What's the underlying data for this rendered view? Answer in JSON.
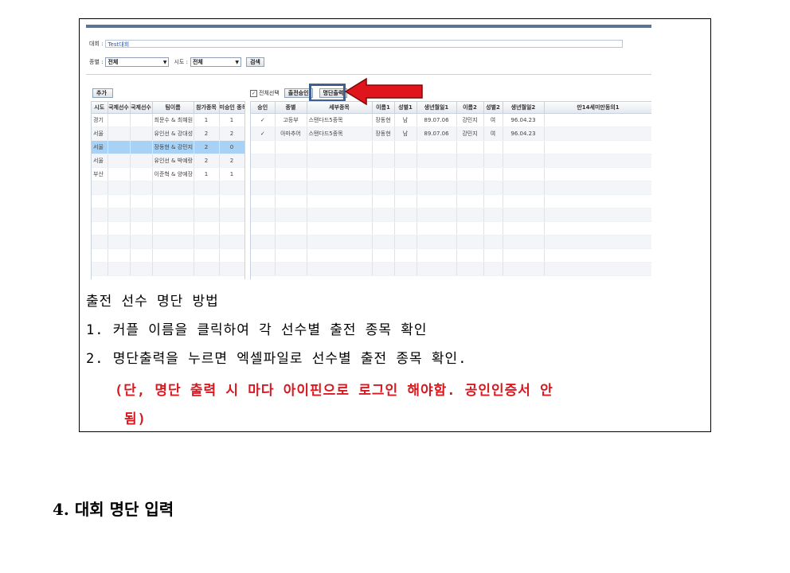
{
  "screenshot": {
    "event_label": "대회 :",
    "event_value": "Test대회",
    "category_label": "종별 :",
    "category_value": "전체",
    "region_label": "시도 :",
    "region_value": "전체",
    "search_label": "검색",
    "add_label": "추가",
    "select_all_label": "전체선택",
    "approve_label": "출전승인",
    "print_list_label": "명단출력",
    "left_headers": [
      "시도",
      "국제선수",
      "국제선수",
      "팀이름",
      "참가종목",
      "미승인 종목"
    ],
    "left_rows": [
      [
        "경기",
        "",
        "",
        "최문수 & 최혜원",
        "1",
        "1"
      ],
      [
        "서울",
        "",
        "",
        "유인선 & 강대성",
        "2",
        "2"
      ],
      [
        "서울",
        "",
        "",
        "장동현 & 강민지",
        "2",
        "0"
      ],
      [
        "서울",
        "",
        "",
        "유인선 & 박예랑",
        "2",
        "2"
      ],
      [
        "부산",
        "",
        "",
        "이준혁 & 양예장",
        "1",
        "1"
      ]
    ],
    "right_headers": [
      "승인",
      "종별",
      "세부종목",
      "이름1",
      "성별1",
      "생년월일1",
      "이름2",
      "성별2",
      "생년월일2",
      "만14세미만동의1"
    ],
    "right_rows": [
      [
        "✓",
        "고등부",
        "스탠다드5종목",
        "장동현",
        "남",
        "89.07.06",
        "강민지",
        "여",
        "96.04.23",
        ""
      ],
      [
        "✓",
        "아마추어",
        "스탠다드5종목",
        "장동현",
        "남",
        "89.07.06",
        "강민지",
        "여",
        "96.04.23",
        ""
      ]
    ]
  },
  "instructions": {
    "title": "출전 선수 명단 방법",
    "step1": "1. 커플 이름을 클릭하여 각 선수별 출전 종목 확인",
    "step2": "2. 명단출력을 누르면 엑셀파일로 선수별 출전 종목 확인.",
    "note_line1": "(단, 명단 출력 시 마다 아이핀으로 로그인 해야함. 공인인증서  안",
    "note_line2": "됨)"
  },
  "section_heading": "4. 대회 명단 입력",
  "colors": {
    "highlight_row": "#a7d2f5",
    "arrow_red": "#e0141c",
    "note_red": "#d71920",
    "frame_blue": "#3e5f8f"
  }
}
